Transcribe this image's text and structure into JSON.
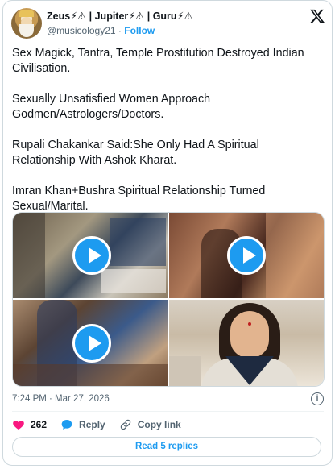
{
  "author": {
    "display_name": "Zeus⚡⚠ | Jupiter⚡⚠ | Guru⚡⚠",
    "handle": "@musicology21",
    "separator": "·",
    "follow_label": "Follow"
  },
  "tweet": {
    "paragraphs": [
      "Sex Magick, Tantra, Temple Prostitution Destroyed Indian Civilisation.",
      "Sexually Unsatisfied Women Approach Godmen/Astrologers/Doctors.",
      "Rupali Chakankar Said:She Only Had A Spiritual Relationship With Ashok Kharat.",
      "Imran Khan+Bushra Spiritual Relationship Turned Sexual/Marital."
    ],
    "timestamp": "7:24 PM · Mar 27, 2026"
  },
  "media": {
    "tiles": [
      {
        "kind": "video"
      },
      {
        "kind": "video"
      },
      {
        "kind": "video"
      },
      {
        "kind": "image"
      }
    ]
  },
  "actions": {
    "like_count": "262",
    "reply_label": "Reply",
    "copy_link_label": "Copy link",
    "read_replies_label": "Read 5 replies"
  },
  "colors": {
    "accent": "#1d9bf0",
    "like": "#f91880",
    "text": "#0f1419",
    "muted": "#536471"
  },
  "icons": {
    "logo": "x-logo-icon",
    "info": "info-icon",
    "like": "heart-icon",
    "reply": "speech-bubble-icon",
    "copy": "link-icon",
    "play": "play-icon"
  }
}
